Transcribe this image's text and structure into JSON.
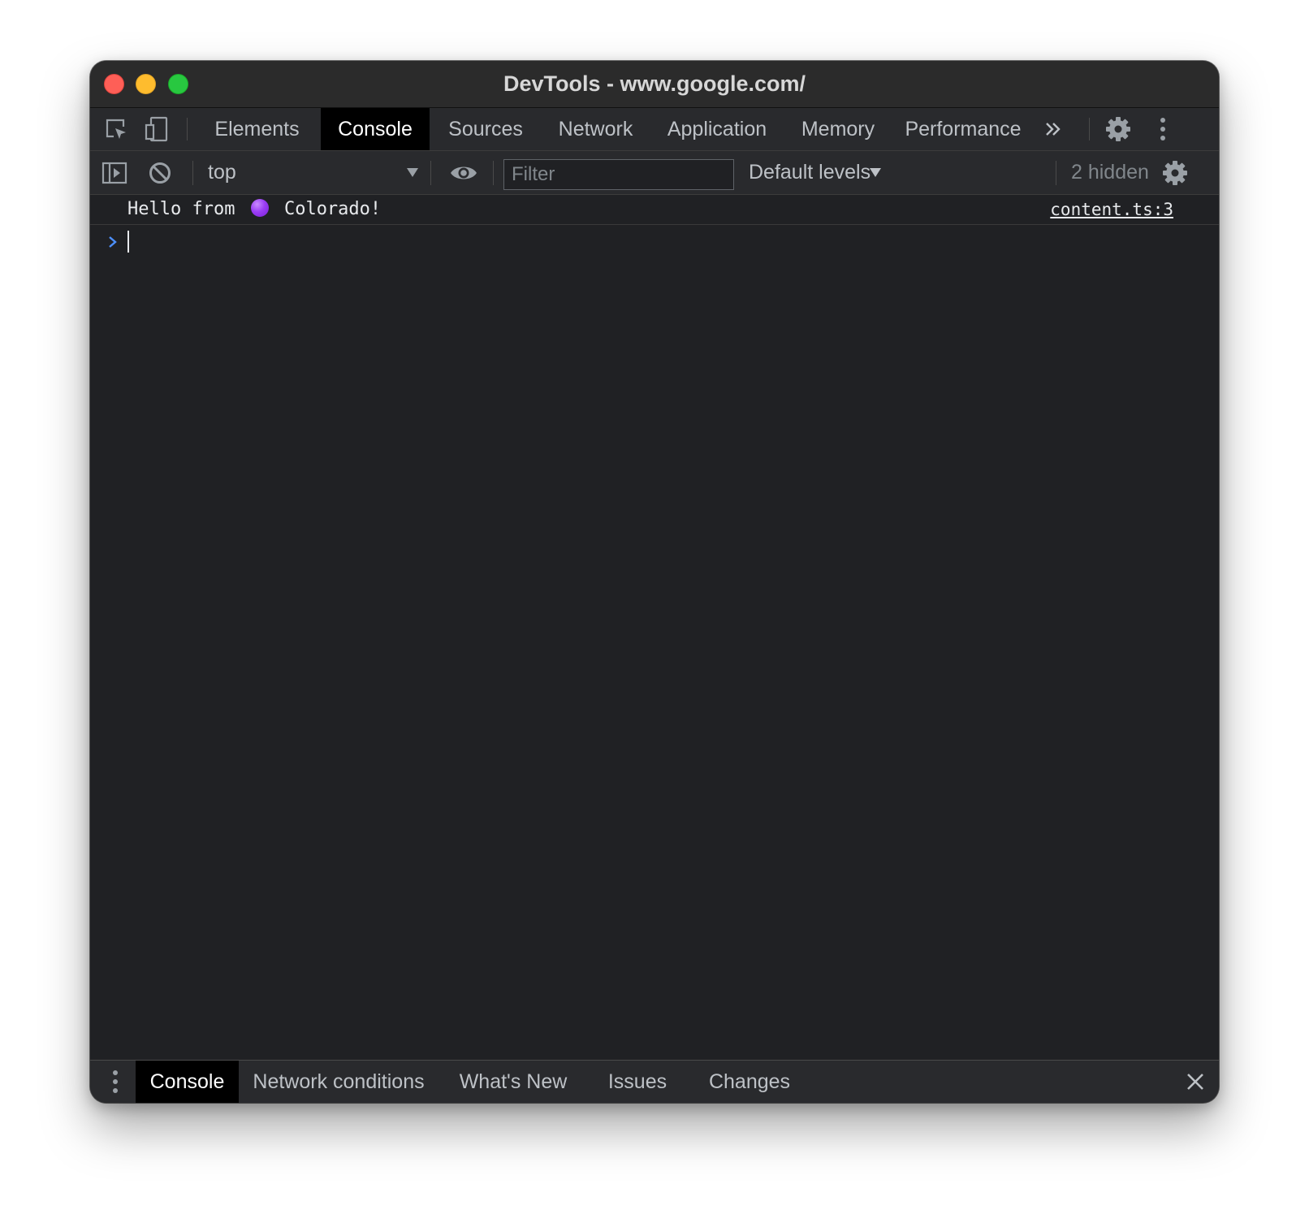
{
  "window": {
    "title": "DevTools - www.google.com/"
  },
  "main_tabs": [
    {
      "label": "Elements",
      "active": false
    },
    {
      "label": "Console",
      "active": true
    },
    {
      "label": "Sources",
      "active": false
    },
    {
      "label": "Network",
      "active": false
    },
    {
      "label": "Application",
      "active": false
    },
    {
      "label": "Memory",
      "active": false
    },
    {
      "label": "Performance",
      "active": false
    }
  ],
  "toolbar": {
    "context": "top",
    "filter": {
      "value": "",
      "placeholder": "Filter"
    },
    "levels": "Default levels",
    "hidden": "2 hidden"
  },
  "console": {
    "messages": [
      {
        "prefix": "Hello from",
        "emoji": "purple-circle-emoji",
        "suffix": "Colorado!",
        "source": "content.ts:3"
      }
    ]
  },
  "drawer_tabs": [
    {
      "label": "Console",
      "active": true
    },
    {
      "label": "Network conditions",
      "active": false
    },
    {
      "label": "What's New",
      "active": false
    },
    {
      "label": "Issues",
      "active": false
    },
    {
      "label": "Changes",
      "active": false
    }
  ],
  "colors": {
    "panel_bg": "#202124",
    "toolbar_bg": "#292a2d",
    "text": "#bdc1c6",
    "active_tab_bg": "#000000",
    "prompt_accent": "#4d90fe",
    "emoji": "#9b3df5"
  }
}
